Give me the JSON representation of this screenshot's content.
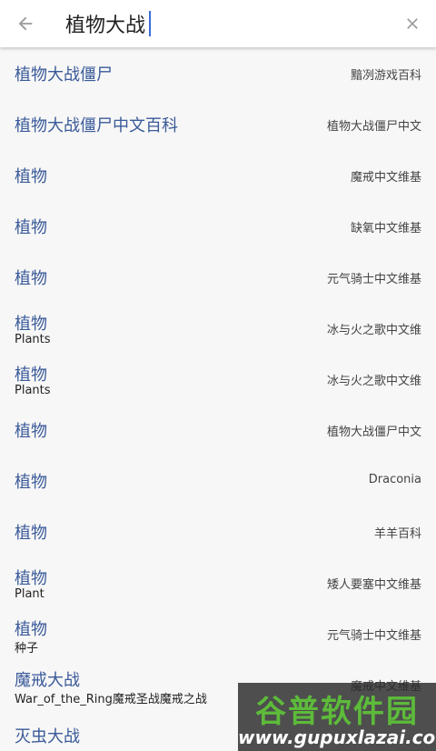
{
  "search": {
    "query": "植物大战"
  },
  "results": [
    {
      "title": "植物大战僵尸",
      "subtitle": "",
      "source": "黯冽游戏百科"
    },
    {
      "title": "植物大战僵尸中文百科",
      "subtitle": "",
      "source": "植物大战僵尸中文"
    },
    {
      "title": "植物",
      "subtitle": "",
      "source": "魔戒中文维基"
    },
    {
      "title": "植物",
      "subtitle": "",
      "source": "缺氧中文维基"
    },
    {
      "title": "植物",
      "subtitle": "",
      "source": "元气骑士中文维基"
    },
    {
      "title": "植物",
      "subtitle": "Plants",
      "source": "冰与火之歌中文维"
    },
    {
      "title": "植物",
      "subtitle": "Plants",
      "source": "冰与火之歌中文维"
    },
    {
      "title": "植物",
      "subtitle": "",
      "source": "植物大战僵尸中文"
    },
    {
      "title": "植物",
      "subtitle": "",
      "source": "Draconia"
    },
    {
      "title": "植物",
      "subtitle": "",
      "source": "羊羊百科"
    },
    {
      "title": "植物",
      "subtitle": "Plant",
      "source": "矮人要塞中文维基"
    },
    {
      "title": "植物",
      "subtitle": "种子",
      "source": "元气骑士中文维基"
    },
    {
      "title": "魔戒大战",
      "subtitle": "War_of_the_Ring魔戒圣战魔戒之战",
      "source": "魔戒中文维基"
    },
    {
      "title": "灭虫大战",
      "subtitle": "",
      "source": ""
    }
  ],
  "watermark": {
    "line1": "谷普软件园",
    "line2": "www.gupuxlazai.com"
  }
}
